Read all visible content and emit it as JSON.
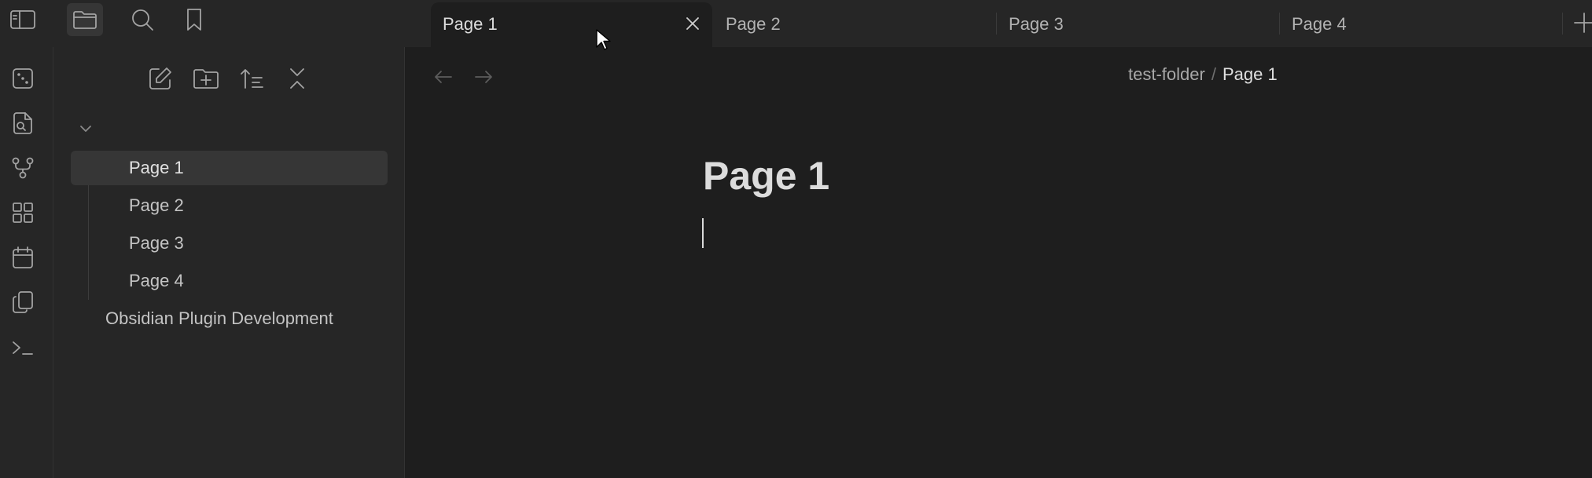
{
  "tabs": [
    {
      "label": "Page 1",
      "active": true
    },
    {
      "label": "Page 2",
      "active": false
    },
    {
      "label": "Page 3",
      "active": false
    },
    {
      "label": "Page 4",
      "active": false
    }
  ],
  "top_icons": [
    "sidebar-toggle-icon",
    "folder-icon",
    "search-icon",
    "bookmark-icon",
    "plus-icon"
  ],
  "ribbon_icons": [
    "dice-icon",
    "file-search-icon",
    "graph-icon",
    "blocks-icon",
    "calendar-icon",
    "copy-icon",
    "terminal-icon"
  ],
  "sidebar": {
    "actions": [
      "new-note-icon",
      "new-folder-icon",
      "sort-icon",
      "collapse-all-icon"
    ],
    "tree": {
      "folder": "test-folder",
      "items": [
        "Page 1",
        "Page 2",
        "Page 3",
        "Page 4"
      ],
      "root_item": "Obsidian Plugin Development"
    }
  },
  "breadcrumb": {
    "folder": "test-folder",
    "separator": "/",
    "current": "Page 1"
  },
  "document": {
    "title": "Page 1"
  },
  "colors": {
    "background": "#1e1e1e",
    "panel": "#262626",
    "active_item": "#363636",
    "text": "#dadada"
  }
}
